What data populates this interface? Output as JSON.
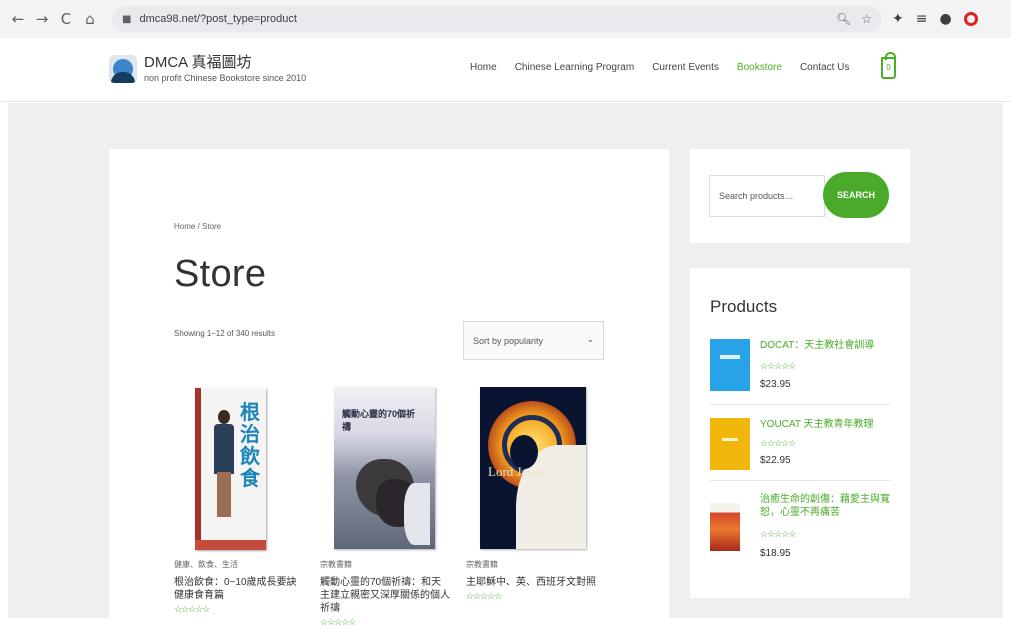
{
  "browser": {
    "nav_back": "←",
    "nav_forward": "→",
    "nav_reload": "C",
    "nav_home": "⌂",
    "url": "dmca98.net/?post_type=product"
  },
  "site": {
    "title": "DMCA 真福圖坊",
    "tagline": "non profit Chinese Bookstore since 2010",
    "nav": [
      "Home",
      "Chinese Learning Program",
      "Current Events",
      "Bookstore",
      "Contact Us"
    ],
    "active_nav": "Bookstore",
    "cart_count": "0",
    "accent_color": "#4caf2a"
  },
  "main": {
    "breadcrumb": "Home / Store",
    "title": "Store",
    "results_count": "Showing 1–12 of 340 results",
    "sort_value": "Sort by popularity",
    "products": [
      {
        "category": "健康、飲食、生活",
        "name": "根治飲食：0~10歲成長要訣 健康食育篇",
        "cover_text": "根治飲食",
        "stars": "☆☆☆☆☆"
      },
      {
        "category": "宗教書籍",
        "name": "觸動心靈的70個祈禱：和天主建立親密又深厚關係的個人祈禱",
        "cover_text": "觸動心靈的70個祈禱",
        "stars": "☆☆☆☆☆"
      },
      {
        "category": "宗教書籍",
        "name": "主耶穌中、英、西班牙文對照",
        "cover_text": "Lord Jesus",
        "stars": "☆☆☆☆☆"
      }
    ]
  },
  "sidebar": {
    "search_placeholder": "Search products…",
    "search_button": "SEARCH",
    "products_title": "Products",
    "products": [
      {
        "name": "DOCAT：天主教社會訓導",
        "stars": "☆☆☆☆☆",
        "price": "$23.95"
      },
      {
        "name": "YOUCAT 天主教青年教理",
        "stars": "☆☆☆☆☆",
        "price": "$22.95"
      },
      {
        "name": "治癒生命的創傷：藉愛主與寬恕，心靈不再痛苦",
        "stars": "☆☆☆☆☆",
        "price": "$18.95"
      }
    ]
  }
}
